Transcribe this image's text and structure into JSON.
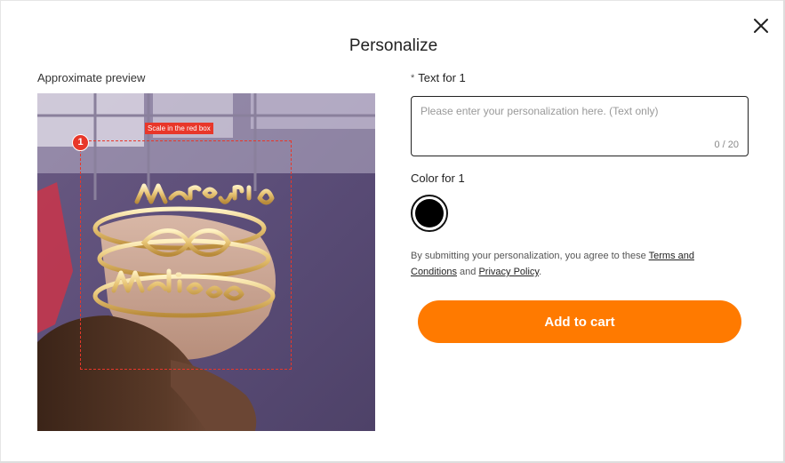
{
  "modal": {
    "title": "Personalize",
    "close_icon": "close-icon"
  },
  "preview": {
    "label": "Approximate preview",
    "badge_number": "1",
    "scale_tag": "Scale in the red box",
    "image_description_icon": "ring-photo"
  },
  "text_field": {
    "required_mark": "*",
    "label": "Text for 1",
    "value": "",
    "placeholder": "Please enter your personalization here. (Text only)",
    "counter": "0 / 20"
  },
  "color_field": {
    "label": "Color for 1",
    "selected_color": "#000000"
  },
  "agreement": {
    "prefix": "By submitting your personalization, you agree to these ",
    "terms_link": "Terms and Conditions",
    "middle": " and ",
    "privacy_link": "Privacy Policy",
    "suffix": "."
  },
  "actions": {
    "add_to_cart_label": "Add to cart",
    "accent_color": "#ff7a00"
  }
}
